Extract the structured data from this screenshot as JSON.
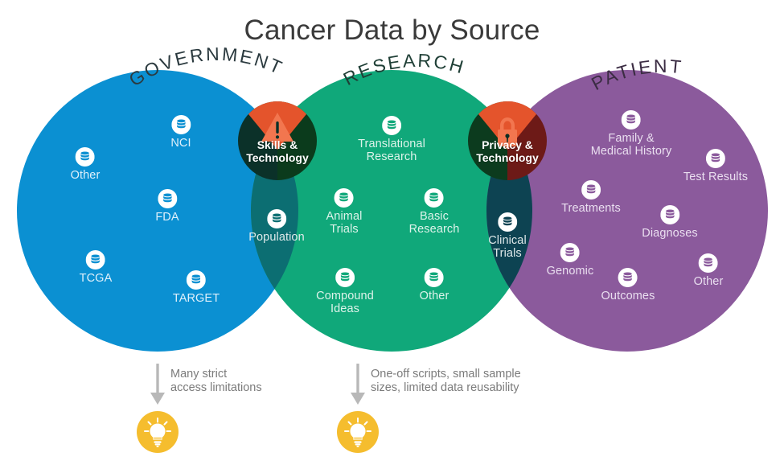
{
  "title": "Cancer Data by Source",
  "colors": {
    "government": "#0b90d2",
    "research": "#10a87a",
    "patient": "#8b5a9c",
    "overlap_left_lens": "#0c6e72",
    "overlap_right_lens": "#0d4352",
    "dark_circle_left_a": "#0b3129",
    "dark_circle_left_b": "#0b3b1c",
    "dark_circle_right_a": "#0c3b1e",
    "dark_circle_right_b": "#6d1a17",
    "wedge_orange": "#e4542c",
    "lock_icon": "#f2764f",
    "warning_icon": "#f2764f",
    "bulb_circle": "#f5bd2e",
    "annotation_text": "#7b7b7b",
    "title_text": "#3a3a3a",
    "circle_heading_text": "#2b3a3f"
  },
  "circles": [
    {
      "id": "government",
      "heading": "GOVERNMENT"
    },
    {
      "id": "research",
      "heading": "RESEARCH"
    },
    {
      "id": "patient",
      "heading": "PATIENT"
    }
  ],
  "government_nodes": [
    {
      "label": "NCI",
      "icon": "database-icon"
    },
    {
      "label": "Other",
      "icon": "database-icon"
    },
    {
      "label": "FDA",
      "icon": "database-icon"
    },
    {
      "label": "TCGA",
      "icon": "database-icon"
    },
    {
      "label": "TARGET",
      "icon": "database-icon"
    }
  ],
  "research_nodes": [
    {
      "label": "Translational\nResearch",
      "line1": "Translational",
      "line2": "Research",
      "icon": "database-icon"
    },
    {
      "label": "Animal\nTrials",
      "line1": "Animal",
      "line2": "Trials",
      "icon": "database-icon"
    },
    {
      "label": "Basic\nResearch",
      "line1": "Basic",
      "line2": "Research",
      "icon": "database-icon"
    },
    {
      "label": "Compound\nIdeas",
      "line1": "Compound",
      "line2": "Ideas",
      "icon": "database-icon"
    },
    {
      "label": "Other",
      "line1": "Other",
      "line2": "",
      "icon": "database-icon"
    }
  ],
  "patient_nodes": [
    {
      "line1": "Family &",
      "line2": "Medical History",
      "icon": "database-icon"
    },
    {
      "line1": "Test Results",
      "line2": "",
      "icon": "database-icon"
    },
    {
      "line1": "Treatments",
      "line2": "",
      "icon": "database-icon"
    },
    {
      "line1": "Diagnoses",
      "line2": "",
      "icon": "database-icon"
    },
    {
      "line1": "Genomic",
      "line2": "",
      "icon": "database-icon"
    },
    {
      "line1": "Outcomes",
      "line2": "",
      "icon": "database-icon"
    },
    {
      "line1": "Other",
      "line2": "",
      "icon": "database-icon"
    }
  ],
  "overlap_nodes": [
    {
      "id": "population",
      "line1": "Population",
      "line2": "",
      "icon": "database-icon"
    },
    {
      "id": "clinical-trials",
      "line1": "Clinical",
      "line2": "Trials",
      "icon": "database-icon"
    }
  ],
  "overlap_warnings": [
    {
      "id": "skills-technology",
      "line1": "Skills &",
      "line2": "Technology",
      "icon": "warning-triangle-icon"
    },
    {
      "id": "privacy-technology",
      "line1": "Privacy &",
      "line2": "Technology",
      "icon": "lock-icon"
    }
  ],
  "annotations": [
    {
      "id": "government-annotation",
      "line1": "Many strict",
      "line2": "access limitations",
      "icon": "lightbulb-icon",
      "arrow": "down-arrow-icon"
    },
    {
      "id": "research-annotation",
      "line1": "One-off scripts, small sample",
      "line2": "sizes, limited data reusability",
      "icon": "lightbulb-icon",
      "arrow": "down-arrow-icon"
    }
  ]
}
